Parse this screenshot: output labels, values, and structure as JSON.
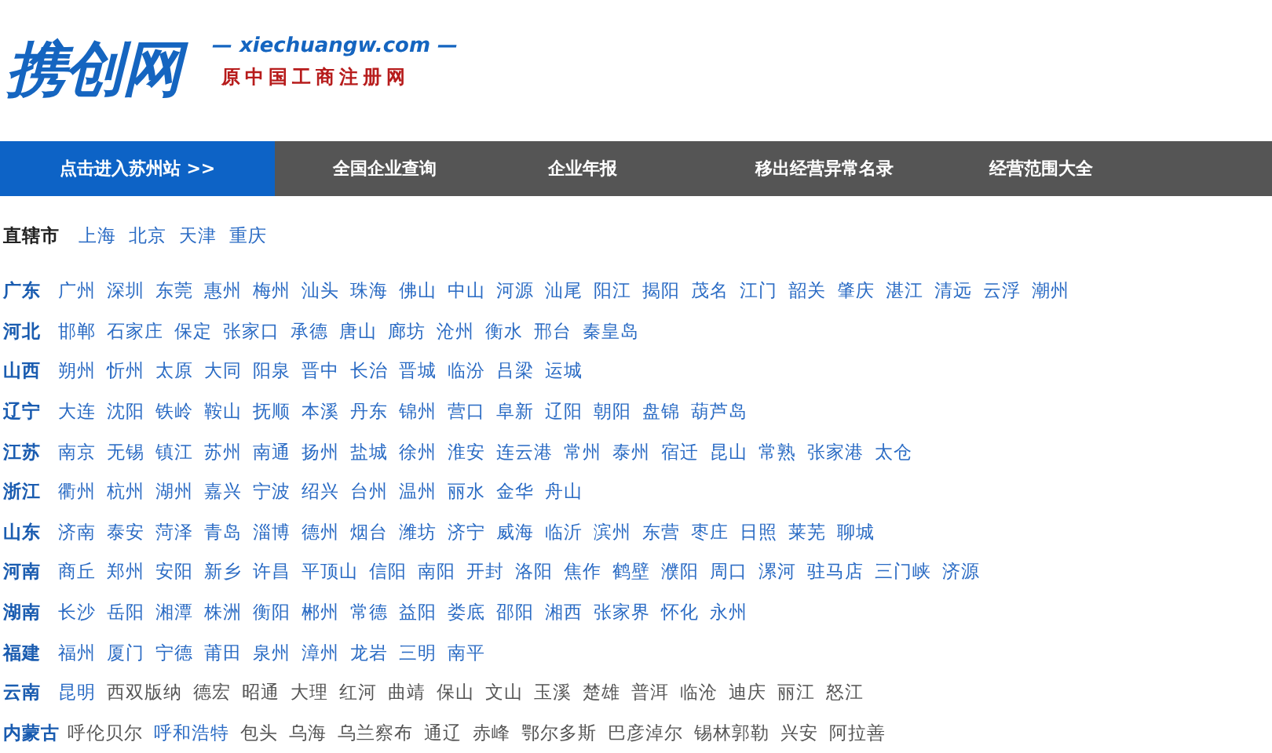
{
  "logo": {
    "name": "携创网",
    "domain": "— xiechuangw.com —",
    "tagline": "原中国工商注册网"
  },
  "nav": [
    {
      "label": "点击进入苏州站 >>",
      "selected": true
    },
    {
      "label": "全国企业查询",
      "selected": false
    },
    {
      "label": "企业年报",
      "selected": false
    },
    {
      "label": "移出经营异常名录",
      "selected": false
    },
    {
      "label": "经营范围大全",
      "selected": false
    }
  ],
  "municipalities": {
    "label": "直辖市",
    "cities": [
      "上海",
      "北京",
      "天津",
      "重庆"
    ]
  },
  "provinces": [
    {
      "name": "广东",
      "cities": [
        {
          "name": "广州",
          "linked": true
        },
        {
          "name": "深圳",
          "linked": true
        },
        {
          "name": "东莞",
          "linked": true
        },
        {
          "name": "惠州",
          "linked": true
        },
        {
          "name": "梅州",
          "linked": true
        },
        {
          "name": "汕头",
          "linked": true
        },
        {
          "name": "珠海",
          "linked": true
        },
        {
          "name": "佛山",
          "linked": true
        },
        {
          "name": "中山",
          "linked": true
        },
        {
          "name": "河源",
          "linked": true
        },
        {
          "name": "汕尾",
          "linked": true
        },
        {
          "name": "阳江",
          "linked": true
        },
        {
          "name": "揭阳",
          "linked": true
        },
        {
          "name": "茂名",
          "linked": true
        },
        {
          "name": "江门",
          "linked": true
        },
        {
          "name": "韶关",
          "linked": true
        },
        {
          "name": "肇庆",
          "linked": true
        },
        {
          "name": "湛江",
          "linked": true
        },
        {
          "name": "清远",
          "linked": true
        },
        {
          "name": "云浮",
          "linked": true
        },
        {
          "name": "潮州",
          "linked": true
        }
      ]
    },
    {
      "name": "河北",
      "cities": [
        {
          "name": "邯郸",
          "linked": true
        },
        {
          "name": "石家庄",
          "linked": true
        },
        {
          "name": "保定",
          "linked": true
        },
        {
          "name": "张家口",
          "linked": true
        },
        {
          "name": "承德",
          "linked": true
        },
        {
          "name": "唐山",
          "linked": true
        },
        {
          "name": "廊坊",
          "linked": true
        },
        {
          "name": "沧州",
          "linked": true
        },
        {
          "name": "衡水",
          "linked": true
        },
        {
          "name": "邢台",
          "linked": true
        },
        {
          "name": "秦皇岛",
          "linked": true
        }
      ]
    },
    {
      "name": "山西",
      "cities": [
        {
          "name": "朔州",
          "linked": true
        },
        {
          "name": "忻州",
          "linked": true
        },
        {
          "name": "太原",
          "linked": true
        },
        {
          "name": "大同",
          "linked": true
        },
        {
          "name": "阳泉",
          "linked": true
        },
        {
          "name": "晋中",
          "linked": true
        },
        {
          "name": "长治",
          "linked": true
        },
        {
          "name": "晋城",
          "linked": true
        },
        {
          "name": "临汾",
          "linked": true
        },
        {
          "name": "吕梁",
          "linked": true
        },
        {
          "name": "运城",
          "linked": true
        }
      ]
    },
    {
      "name": "辽宁",
      "cities": [
        {
          "name": "大连",
          "linked": true
        },
        {
          "name": "沈阳",
          "linked": true
        },
        {
          "name": "铁岭",
          "linked": true
        },
        {
          "name": "鞍山",
          "linked": true
        },
        {
          "name": "抚顺",
          "linked": true
        },
        {
          "name": "本溪",
          "linked": true
        },
        {
          "name": "丹东",
          "linked": true
        },
        {
          "name": "锦州",
          "linked": true
        },
        {
          "name": "营口",
          "linked": true
        },
        {
          "name": "阜新",
          "linked": true
        },
        {
          "name": "辽阳",
          "linked": true
        },
        {
          "name": "朝阳",
          "linked": true
        },
        {
          "name": "盘锦",
          "linked": true
        },
        {
          "name": "葫芦岛",
          "linked": true
        }
      ]
    },
    {
      "name": "江苏",
      "cities": [
        {
          "name": "南京",
          "linked": true
        },
        {
          "name": "无锡",
          "linked": true
        },
        {
          "name": "镇江",
          "linked": true
        },
        {
          "name": "苏州",
          "linked": true
        },
        {
          "name": "南通",
          "linked": true
        },
        {
          "name": "扬州",
          "linked": true
        },
        {
          "name": "盐城",
          "linked": true
        },
        {
          "name": "徐州",
          "linked": true
        },
        {
          "name": "淮安",
          "linked": true
        },
        {
          "name": "连云港",
          "linked": true
        },
        {
          "name": "常州",
          "linked": true
        },
        {
          "name": "泰州",
          "linked": true
        },
        {
          "name": "宿迁",
          "linked": true
        },
        {
          "name": "昆山",
          "linked": true
        },
        {
          "name": "常熟",
          "linked": true
        },
        {
          "name": "张家港",
          "linked": true
        },
        {
          "name": "太仓",
          "linked": true
        }
      ]
    },
    {
      "name": "浙江",
      "cities": [
        {
          "name": "衢州",
          "linked": true
        },
        {
          "name": "杭州",
          "linked": true
        },
        {
          "name": "湖州",
          "linked": true
        },
        {
          "name": "嘉兴",
          "linked": true
        },
        {
          "name": "宁波",
          "linked": true
        },
        {
          "name": "绍兴",
          "linked": true
        },
        {
          "name": "台州",
          "linked": true
        },
        {
          "name": "温州",
          "linked": true
        },
        {
          "name": "丽水",
          "linked": true
        },
        {
          "name": "金华",
          "linked": true
        },
        {
          "name": "舟山",
          "linked": true
        }
      ]
    },
    {
      "name": "山东",
      "cities": [
        {
          "name": "济南",
          "linked": true
        },
        {
          "name": "泰安",
          "linked": true
        },
        {
          "name": "菏泽",
          "linked": true
        },
        {
          "name": "青岛",
          "linked": true
        },
        {
          "name": "淄博",
          "linked": true
        },
        {
          "name": "德州",
          "linked": true
        },
        {
          "name": "烟台",
          "linked": true
        },
        {
          "name": "潍坊",
          "linked": true
        },
        {
          "name": "济宁",
          "linked": true
        },
        {
          "name": "威海",
          "linked": true
        },
        {
          "name": "临沂",
          "linked": true
        },
        {
          "name": "滨州",
          "linked": true
        },
        {
          "name": "东营",
          "linked": true
        },
        {
          "name": "枣庄",
          "linked": true
        },
        {
          "name": "日照",
          "linked": true
        },
        {
          "name": "莱芜",
          "linked": true
        },
        {
          "name": "聊城",
          "linked": true
        }
      ]
    },
    {
      "name": "河南",
      "cities": [
        {
          "name": "商丘",
          "linked": true
        },
        {
          "name": "郑州",
          "linked": true
        },
        {
          "name": "安阳",
          "linked": true
        },
        {
          "name": "新乡",
          "linked": true
        },
        {
          "name": "许昌",
          "linked": true
        },
        {
          "name": "平顶山",
          "linked": true
        },
        {
          "name": "信阳",
          "linked": true
        },
        {
          "name": "南阳",
          "linked": true
        },
        {
          "name": "开封",
          "linked": true
        },
        {
          "name": "洛阳",
          "linked": true
        },
        {
          "name": "焦作",
          "linked": true
        },
        {
          "name": "鹤壁",
          "linked": true
        },
        {
          "name": "濮阳",
          "linked": true
        },
        {
          "name": "周口",
          "linked": true
        },
        {
          "name": "漯河",
          "linked": true
        },
        {
          "name": "驻马店",
          "linked": true
        },
        {
          "name": "三门峡",
          "linked": true
        },
        {
          "name": "济源",
          "linked": true
        }
      ]
    },
    {
      "name": "湖南",
      "cities": [
        {
          "name": "长沙",
          "linked": true
        },
        {
          "name": "岳阳",
          "linked": true
        },
        {
          "name": "湘潭",
          "linked": true
        },
        {
          "name": "株洲",
          "linked": true
        },
        {
          "name": "衡阳",
          "linked": true
        },
        {
          "name": "郴州",
          "linked": true
        },
        {
          "name": "常德",
          "linked": true
        },
        {
          "name": "益阳",
          "linked": true
        },
        {
          "name": "娄底",
          "linked": true
        },
        {
          "name": "邵阳",
          "linked": true
        },
        {
          "name": "湘西",
          "linked": true
        },
        {
          "name": "张家界",
          "linked": true
        },
        {
          "name": "怀化",
          "linked": true
        },
        {
          "name": "永州",
          "linked": true
        }
      ]
    },
    {
      "name": "福建",
      "cities": [
        {
          "name": "福州",
          "linked": true
        },
        {
          "name": "厦门",
          "linked": true
        },
        {
          "name": "宁德",
          "linked": true
        },
        {
          "name": "莆田",
          "linked": true
        },
        {
          "name": "泉州",
          "linked": true
        },
        {
          "name": "漳州",
          "linked": true
        },
        {
          "name": "龙岩",
          "linked": true
        },
        {
          "name": "三明",
          "linked": true
        },
        {
          "name": "南平",
          "linked": true
        }
      ]
    },
    {
      "name": "云南",
      "cities": [
        {
          "name": "昆明",
          "linked": true
        },
        {
          "name": "西双版纳",
          "linked": false
        },
        {
          "name": "德宏",
          "linked": false
        },
        {
          "name": "昭通",
          "linked": false
        },
        {
          "name": "大理",
          "linked": false
        },
        {
          "name": "红河",
          "linked": false
        },
        {
          "name": "曲靖",
          "linked": false
        },
        {
          "name": "保山",
          "linked": false
        },
        {
          "name": "文山",
          "linked": false
        },
        {
          "name": "玉溪",
          "linked": false
        },
        {
          "name": "楚雄",
          "linked": false
        },
        {
          "name": "普洱",
          "linked": false
        },
        {
          "name": "临沧",
          "linked": false
        },
        {
          "name": "迪庆",
          "linked": false
        },
        {
          "name": "丽江",
          "linked": false
        },
        {
          "name": "怒江",
          "linked": false
        }
      ]
    },
    {
      "name": "内蒙古",
      "cities": [
        {
          "name": "呼伦贝尔",
          "linked": false
        },
        {
          "name": "呼和浩特",
          "linked": true
        },
        {
          "name": "包头",
          "linked": false
        },
        {
          "name": "乌海",
          "linked": false
        },
        {
          "name": "乌兰察布",
          "linked": false
        },
        {
          "name": "通辽",
          "linked": false
        },
        {
          "name": "赤峰",
          "linked": false
        },
        {
          "name": "鄂尔多斯",
          "linked": false
        },
        {
          "name": "巴彦淖尔",
          "linked": false
        },
        {
          "name": "锡林郭勒",
          "linked": false
        },
        {
          "name": "兴安",
          "linked": false
        },
        {
          "name": "阿拉善",
          "linked": false
        }
      ]
    }
  ]
}
